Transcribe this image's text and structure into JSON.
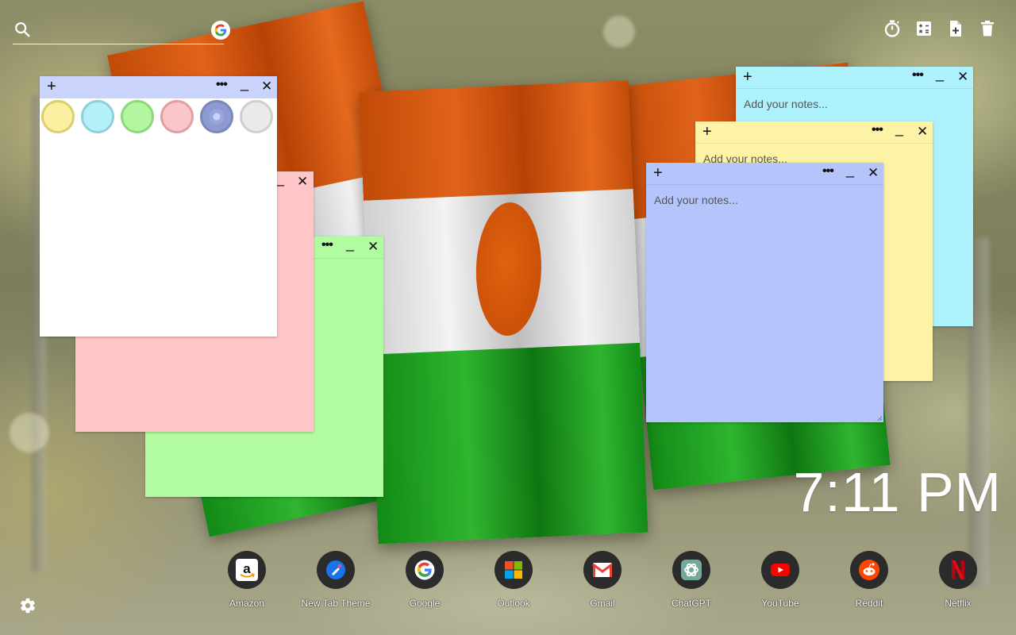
{
  "search": {
    "placeholder": ""
  },
  "toolbar": {
    "icons": [
      "timer-icon",
      "calculator-icon",
      "new-note-icon",
      "trash-icon"
    ]
  },
  "palette": {
    "colors": [
      "#fbf0a0",
      "#b4f0fa",
      "#b4f5a0",
      "#fbc6c8",
      "#8e9bd0",
      "#eaeaea"
    ],
    "borders": [
      "#d9cf70",
      "#8fcfdb",
      "#8fd77b",
      "#e0a0a3",
      "#7b87bc",
      "#cfcfcf"
    ]
  },
  "notes": {
    "cyan": {
      "placeholder": "Add your notes...",
      "color": "#adf1fc"
    },
    "yellow": {
      "placeholder": "Add your notes...",
      "color": "#fdf3a6"
    },
    "blue": {
      "placeholder": "Add your notes...",
      "color": "#b5c5fc"
    },
    "pink": {
      "color": "#fec6c7"
    },
    "green": {
      "color": "#b1fca0"
    },
    "white": {
      "color": "#ffffff",
      "header_color": "#c9d3fb"
    }
  },
  "clock": {
    "time": "7:11 PM"
  },
  "dock": [
    {
      "label": "Amazon",
      "icon": "amazon-icon"
    },
    {
      "label": "New Tab Theme",
      "icon": "new-tab-theme-icon"
    },
    {
      "label": "Google",
      "icon": "google-icon"
    },
    {
      "label": "Outlook",
      "icon": "outlook-icon"
    },
    {
      "label": "Gmail",
      "icon": "gmail-icon"
    },
    {
      "label": "ChatGPT",
      "icon": "chatgpt-icon"
    },
    {
      "label": "YouTube",
      "icon": "youtube-icon"
    },
    {
      "label": "Reddit",
      "icon": "reddit-icon"
    },
    {
      "label": "Netflix",
      "icon": "netflix-icon"
    }
  ]
}
